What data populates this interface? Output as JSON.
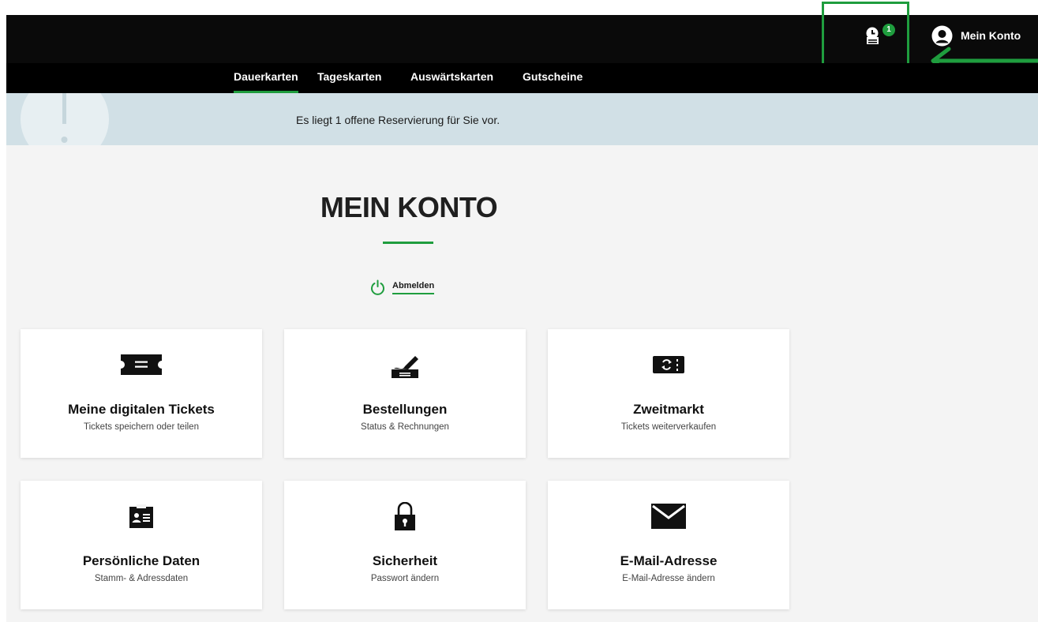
{
  "header": {
    "reservation_badge": "1",
    "account_label": "Mein Konto"
  },
  "nav": {
    "items": [
      {
        "label": "Dauerkarten",
        "active": true
      },
      {
        "label": "Tageskarten",
        "active": false
      },
      {
        "label": "Auswärtskarten",
        "active": false
      },
      {
        "label": "Gutscheine",
        "active": false
      }
    ]
  },
  "alert": {
    "text": "Es liegt 1 offene Reservierung für Sie vor."
  },
  "main": {
    "title": "MEIN KONTO",
    "logout_label": "Abmelden"
  },
  "cards": [
    {
      "title": "Meine digitalen Tickets",
      "subtitle": "Tickets speichern oder teilen",
      "icon": "ticket-icon"
    },
    {
      "title": "Bestellungen",
      "subtitle": "Status & Rechnungen",
      "icon": "order-sign-icon"
    },
    {
      "title": "Zweitmarkt",
      "subtitle": "Tickets weiterverkaufen",
      "icon": "resale-ticket-icon"
    },
    {
      "title": "Persönliche Daten",
      "subtitle": "Stamm- & Adressdaten",
      "icon": "id-card-icon"
    },
    {
      "title": "Sicherheit",
      "subtitle": "Passwort ändern",
      "icon": "lock-icon"
    },
    {
      "title": "E-Mail-Adresse",
      "subtitle": "E-Mail-Adresse ändern",
      "icon": "envelope-icon"
    }
  ],
  "colors": {
    "accent_green": "#1f9d3e",
    "header_black": "#0a0a0a",
    "alert_background": "#d1e0e6",
    "page_background": "#f4f4f4"
  }
}
